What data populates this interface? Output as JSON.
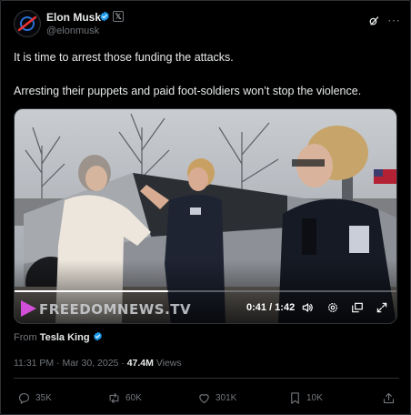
{
  "author": {
    "name": "Elon Musk",
    "handle": "@elonmusk",
    "verified_color": "#1d9bf0"
  },
  "post": {
    "line1": "It is time to arrest those funding the attacks.",
    "line2": "Arresting their puppets and paid foot-soldiers won’t stop the violence."
  },
  "video": {
    "watermark": "FREEDOMNEWS.TV",
    "time": "0:41 / 1:42",
    "progress": 0.4
  },
  "source": {
    "prefix": "From",
    "name": "Tesla King"
  },
  "meta": {
    "timestamp": "11:31 PM · Mar 30, 2025 ·",
    "views_count": "47.4M",
    "views_label": "Views"
  },
  "actions": {
    "replies": "35K",
    "reposts": "60K",
    "likes": "301K",
    "bookmarks": "10K"
  },
  "icons": [
    "avatar-logo-icon",
    "verified-icon",
    "x-premium-icon",
    "grok-icon",
    "more-icon",
    "play-icon",
    "volume-icon",
    "settings-icon",
    "picture-in-picture-icon",
    "fullscreen-icon",
    "reply-icon",
    "repost-icon",
    "like-icon",
    "bookmark-icon",
    "share-icon"
  ]
}
